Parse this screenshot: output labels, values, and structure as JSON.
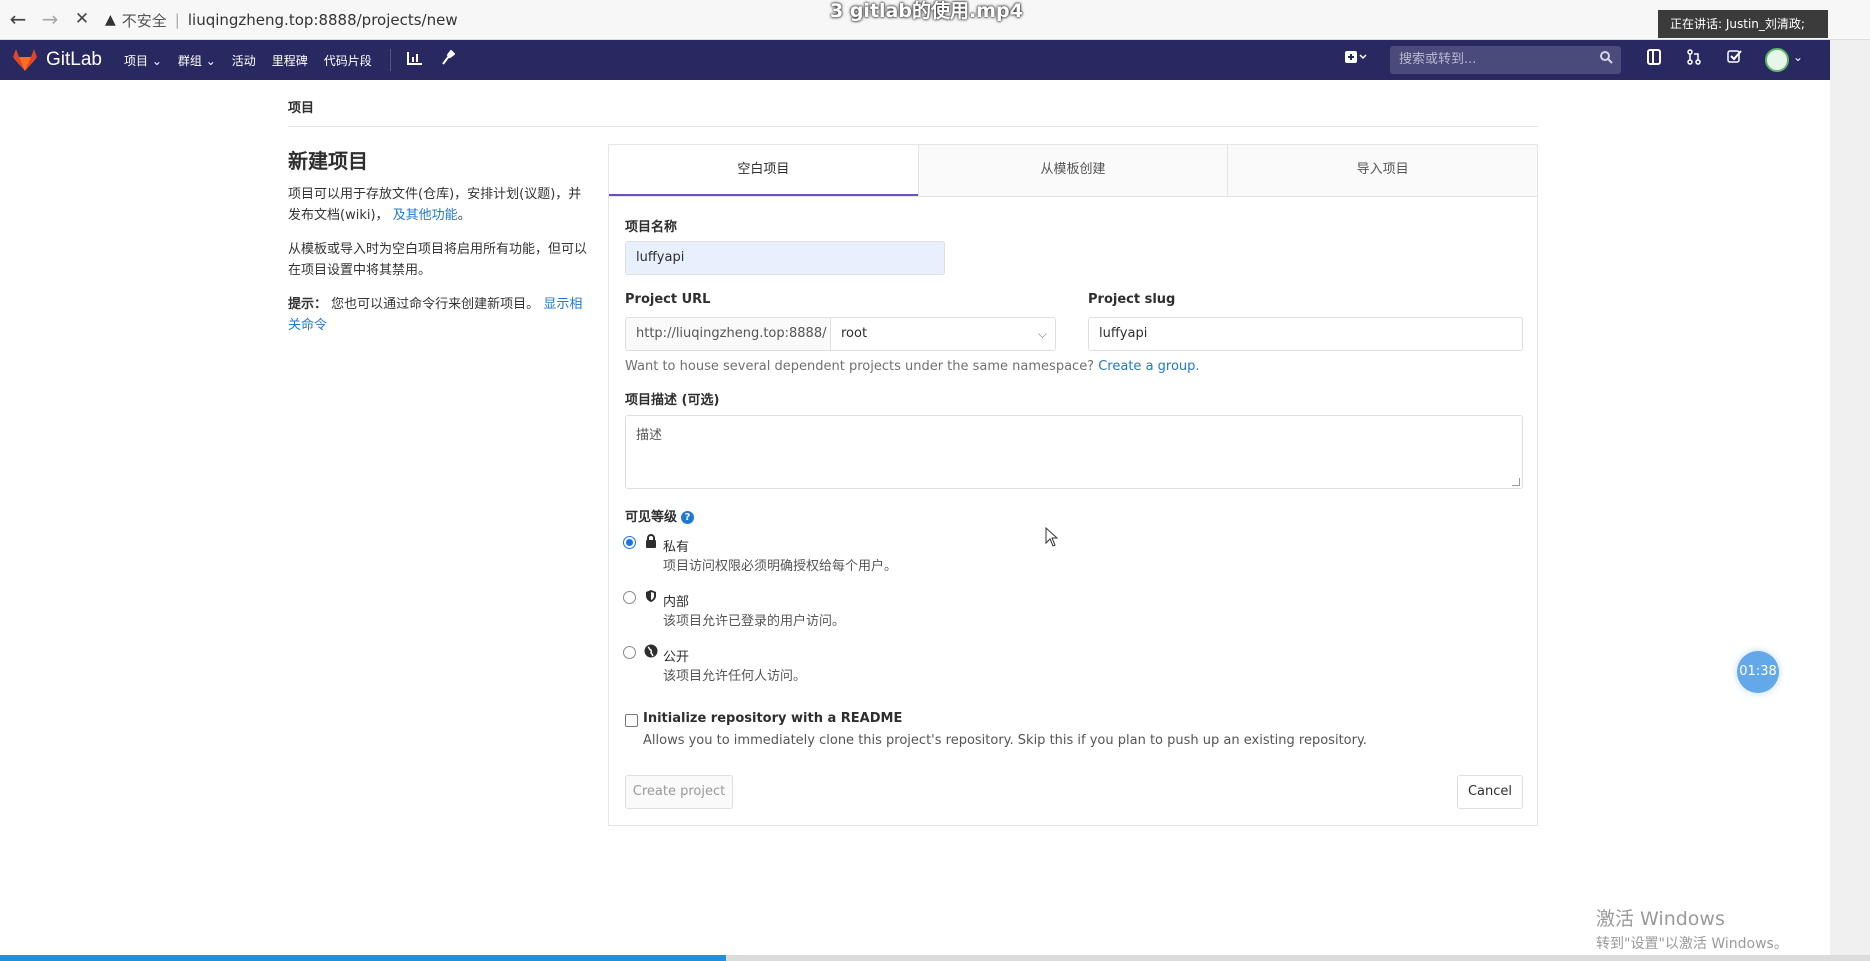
{
  "browser": {
    "back": "←",
    "forward": "→",
    "reload": "✕",
    "warning_icon": "▲",
    "insecure_label": "不安全",
    "url": "liuqingzheng.top:8888/projects/new",
    "video_title": "3 gitlab的使用.mp4",
    "speaker": "正在讲话: Justin_刘清政;"
  },
  "header": {
    "brand": "GitLab",
    "nav": [
      "项目 ⌄",
      "群组 ⌄",
      "活动",
      "里程碑",
      "代码片段"
    ],
    "search_placeholder": "搜索或转到...",
    "icons": [
      "plus-square-icon",
      "chart-icon",
      "wrench-icon",
      "search-icon",
      "sidebar-icon",
      "merge-request-icon",
      "todo-icon",
      "avatar"
    ]
  },
  "breadcrumb": "项目",
  "intro": {
    "title": "新建项目",
    "desc1": "项目可以用于存放文件(仓库)，安排计划(议题)，并发布文档(wiki)，",
    "desc1_link": "及其他功能",
    "desc1_end": "。",
    "desc2": "从模板或导入时为空白项目将启用所有功能，但可以在项目设置中将其禁用。",
    "tip_label": "提示：",
    "tip_text": "您也可以通过命令行来创建新项目。",
    "tip_link": "显示相关命令"
  },
  "tabs": [
    "空白项目",
    "从模板创建",
    "导入项目"
  ],
  "form": {
    "name_label": "项目名称",
    "name_value": "luffyapi",
    "url_label": "Project URL",
    "url_prefix": "http://liuqingzheng.top:8888/",
    "namespace": "root",
    "slug_label": "Project slug",
    "slug_value": "luffyapi",
    "group_help": "Want to house several dependent projects under the same namespace?",
    "group_link": "Create a group.",
    "desc_label": "项目描述 (可选)",
    "desc_placeholder": "描述",
    "visibility_label": "可见等级",
    "visibility": [
      {
        "title": "私有",
        "desc": "项目访问权限必须明确授权给每个用户。",
        "icon": "lock-icon",
        "checked": true
      },
      {
        "title": "内部",
        "desc": "该项目允许已登录的用户访问。",
        "icon": "shield-icon",
        "checked": false
      },
      {
        "title": "公开",
        "desc": "该项目允许任何人访问。",
        "icon": "globe-icon",
        "checked": false
      }
    ],
    "readme_label": "Initialize repository with a README",
    "readme_help": "Allows you to immediately clone this project's repository. Skip this if you plan to push up an existing repository.",
    "create_button": "Create project",
    "cancel_button": "Cancel"
  },
  "overlay": {
    "timer": "01:38",
    "watermark_line1": "激活 Windows",
    "watermark_line2": "转到\"设置\"以激活 Windows。",
    "video_progress": 0.388
  },
  "colors": {
    "header_bg": "#292961",
    "accent": "#6b4fbb",
    "link": "#1f78d1"
  }
}
